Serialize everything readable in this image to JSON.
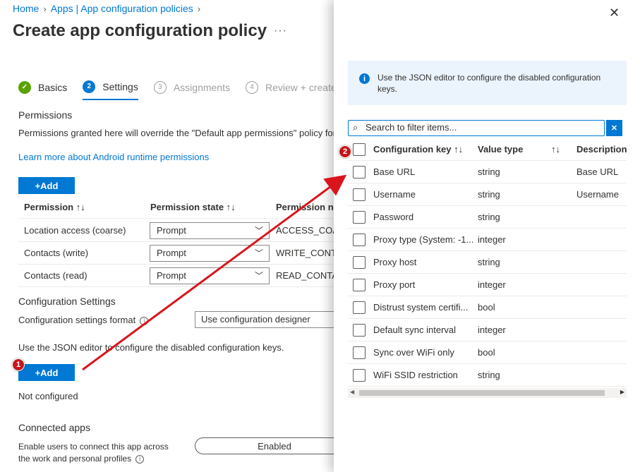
{
  "breadcrumb": {
    "home": "Home",
    "apps": "Apps | App configuration policies"
  },
  "page_title": "Create app configuration policy",
  "more_label": "···",
  "wizard": {
    "steps": [
      {
        "num": "✓",
        "label": "Basics",
        "state": "done"
      },
      {
        "num": "2",
        "label": "Settings",
        "state": "active"
      },
      {
        "num": "3",
        "label": "Assignments",
        "state": "pending"
      },
      {
        "num": "4",
        "label": "Review + create",
        "state": "pending"
      }
    ]
  },
  "permissions": {
    "title": "Permissions",
    "description": "Permissions granted here will override the \"Default app permissions\" policy for",
    "learn_more": "Learn more about Android runtime permissions",
    "add_label": "+Add",
    "columns": [
      "Permission ↑↓",
      "Permission state ↑↓",
      "Permission na"
    ],
    "rows": [
      {
        "name": "Location access (coarse)",
        "state": "Prompt",
        "code": "ACCESS_COAR"
      },
      {
        "name": "Contacts (write)",
        "state": "Prompt",
        "code": "WRITE_CONTA"
      },
      {
        "name": "Contacts (read)",
        "state": "Prompt",
        "code": "READ_CONTAC"
      }
    ]
  },
  "config_settings": {
    "title": "Configuration Settings",
    "format_label": "Configuration settings format",
    "format_value": "Use configuration designer",
    "json_note": "Use the JSON editor to configure the disabled configuration keys.",
    "add_label": "+Add",
    "status": "Not configured"
  },
  "connected_apps": {
    "title": "Connected apps",
    "description_line1": "Enable users to connect this app across",
    "description_line2": "the work and personal profiles",
    "toggle_value": "Enabled"
  },
  "panel": {
    "close_label": "✕",
    "info_text": "Use the JSON editor to configure the disabled configuration keys.",
    "filter_placeholder": "Search to filter items...",
    "clear_label": "✕",
    "columns": [
      "Configuration key ↑↓",
      "Value type",
      "↑↓",
      "Description"
    ],
    "rows": [
      {
        "key": "Base URL",
        "type": "string",
        "desc": "Base URL"
      },
      {
        "key": "Username",
        "type": "string",
        "desc": "Username"
      },
      {
        "key": "Password",
        "type": "string",
        "desc": ""
      },
      {
        "key": "Proxy type (System: -1...",
        "type": "integer",
        "desc": ""
      },
      {
        "key": "Proxy host",
        "type": "string",
        "desc": ""
      },
      {
        "key": "Proxy port",
        "type": "integer",
        "desc": ""
      },
      {
        "key": "Distrust system certifi...",
        "type": "bool",
        "desc": ""
      },
      {
        "key": "Default sync interval",
        "type": "integer",
        "desc": ""
      },
      {
        "key": "Sync over WiFi only",
        "type": "bool",
        "desc": ""
      },
      {
        "key": "WiFi SSID restriction",
        "type": "string",
        "desc": ""
      }
    ]
  },
  "annotations": {
    "marker1": "1",
    "marker2": "2",
    "arrow_color": "#d9141c"
  },
  "colors": {
    "accent": "#0078d4",
    "success": "#57a300"
  }
}
